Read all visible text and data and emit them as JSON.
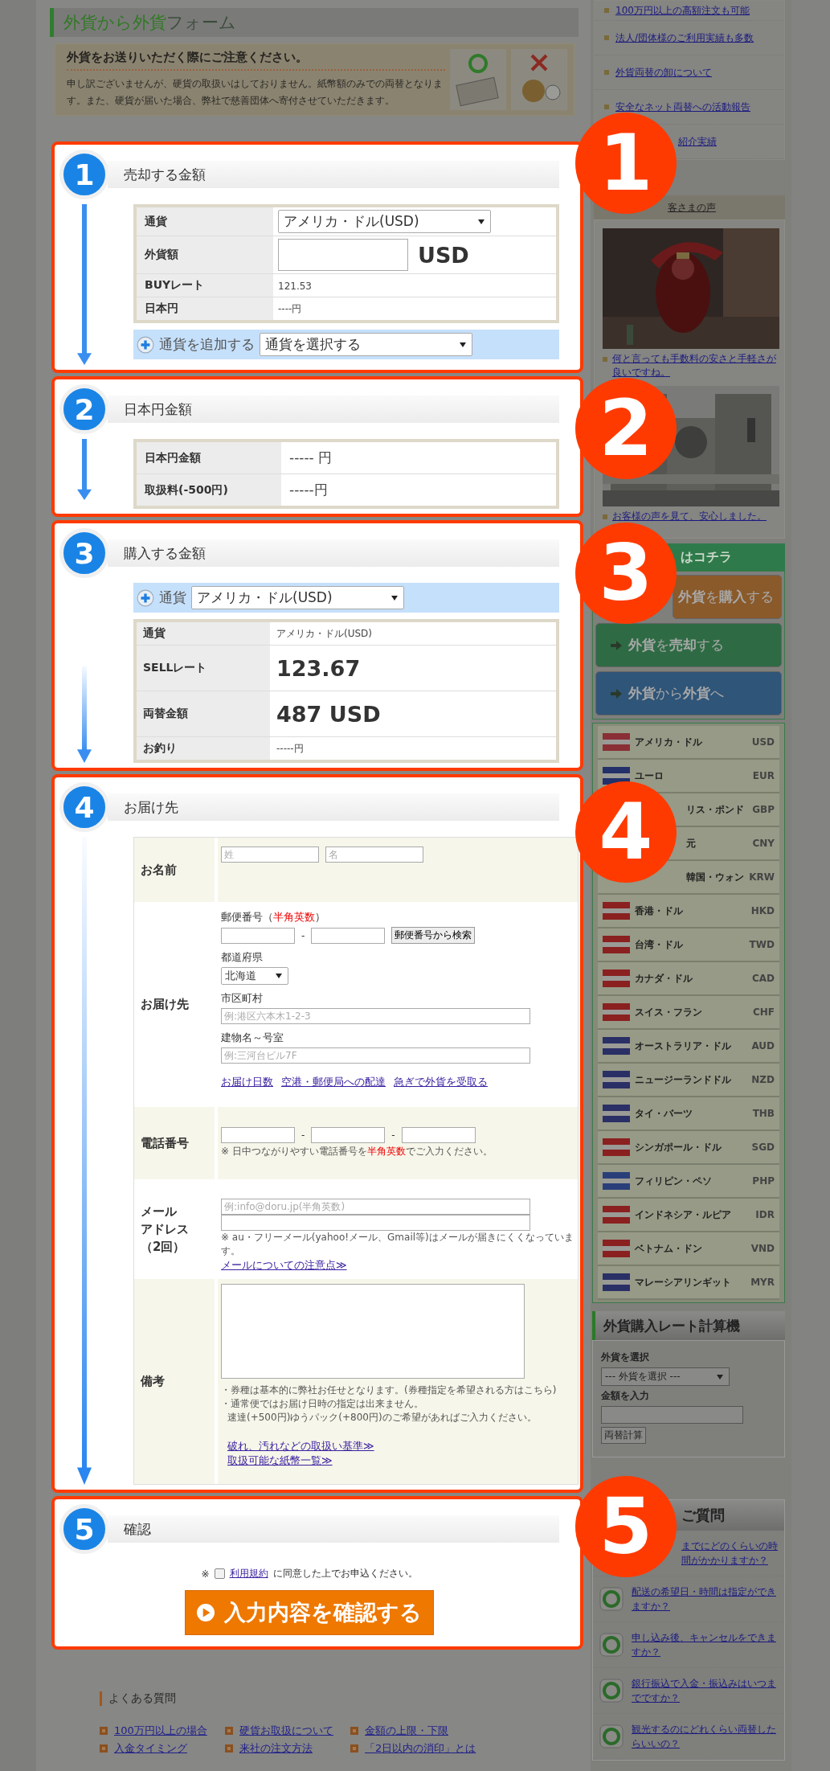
{
  "page_title": {
    "accent": "外貨から外貨",
    "rest": "フォーム"
  },
  "notice": {
    "heading": "外貨をお送りいただく際にご注意ください。",
    "body": "申し訳ございませんが、硬貨の取扱いはしておりません。紙幣額のみでの両替となります。また、硬貨が届いた場合、弊社で慈善団体へ寄付させていただきます。"
  },
  "sell": {
    "step": "1",
    "title": "売却する金額",
    "rows": [
      {
        "label": "通貨",
        "kind": "select",
        "value": "アメリカ・ドル(USD)"
      },
      {
        "label": "外貨額",
        "kind": "input",
        "unit": "USD"
      },
      {
        "label": "BUYレート",
        "kind": "text",
        "value": "121.53"
      },
      {
        "label": "日本円",
        "kind": "text",
        "value": "----円"
      }
    ],
    "add_label": "通貨を追加する",
    "add_select": "通貨を選択する"
  },
  "yen": {
    "step": "2",
    "title": "日本円金額",
    "rows": [
      {
        "label": "日本円金額",
        "kind": "mid",
        "value": "----- 円"
      },
      {
        "label": "取扱料(-500円)",
        "kind": "mid",
        "value": "-----円"
      }
    ]
  },
  "buy": {
    "step": "3",
    "title": "購入する金額",
    "currency_label": "通貨",
    "currency_select": "アメリカ・ドル(USD)",
    "rows": [
      {
        "label": "通貨",
        "kind": "text",
        "value": "アメリカ・ドル(USD)"
      },
      {
        "label": "SELLレート",
        "kind": "big",
        "value": "123.67"
      },
      {
        "label": "両替金額",
        "kind": "big",
        "value": "487  USD"
      },
      {
        "label": "お釣り",
        "kind": "text",
        "value": "-----円"
      }
    ]
  },
  "delivery": {
    "step": "4",
    "title": "お届け先",
    "name": {
      "label": "お名前",
      "last_placeholder": "姓",
      "first_placeholder": "名"
    },
    "address": {
      "label": "お届け先",
      "postal_before": "郵便番号（",
      "postal_red": "半角英数",
      "postal_after": "）",
      "separator": "-",
      "postal_button": "郵便番号から検索",
      "pref_label": "都道府県",
      "pref_value": "北海道",
      "city_label": "市区町村",
      "city_placeholder": "例:港区六本木1-2-3",
      "building_label": "建物名～号室",
      "building_placeholder": "例:三河台ビル7F",
      "links": [
        "お届け日数",
        "空港・郵便局への配達",
        "急ぎで外貨を受取る"
      ]
    },
    "phone": {
      "label": "電話番号",
      "separators": [
        "-",
        "-"
      ],
      "note_before": "※ 日中つながりやすい電話番号を",
      "note_red": "半角英数",
      "note_after": "でご入力ください。"
    },
    "email": {
      "label_lines": [
        "メール",
        "アドレス",
        "（2回）"
      ],
      "placeholder": "例:info@doru.jp(半角英数)",
      "note": "※ au・フリーメール(yahoo!メール、Gmail等)はメールが届きにくくなっています。",
      "link": "メールについての注意点≫"
    },
    "remarks": {
      "label": "備考",
      "line1_before": "・券種は基本的に弊社お任せとなります。(",
      "line1_link": "券種指定を希望される方はこちら",
      "line1_after": ")",
      "line2_before": "・通常便では",
      "line2_link": "お届け日時の指定",
      "line2_after": "は出来ません。",
      "line3": "速達(+500円)ゆうパック(+800円)のご希望があればご入力ください。",
      "links": [
        "破れ、汚れなどの取扱い基準≫",
        "取扱可能な紙幣一覧≫"
      ]
    }
  },
  "confirm": {
    "step": "5",
    "title": "確認",
    "prefix": "※",
    "checked": false,
    "terms_link": "利用規約",
    "terms_after": "に同意した上でお申込ください。",
    "button": "入力内容を確認する"
  },
  "faq_footer": {
    "title": "よくある質問",
    "links": [
      "100万円以上の場合",
      "硬貨お取扱について",
      "金額の上限・下限",
      "入金タイミング",
      "来社の注文方法",
      "「2日以内の消印」とは"
    ]
  },
  "sidebar": {
    "links": [
      {
        "text": "100万円以上の高額注文も可能",
        "partly_covered": false
      },
      {
        "text": "法人/団体様のご利用実績も多数",
        "partly_covered": false
      },
      {
        "text": "外貨両替の卸について",
        "partly_covered": false
      },
      {
        "text": "安全なネット両替への活動報告",
        "partly_covered": false
      },
      {
        "text": "紹介実績",
        "partly_covered": true
      }
    ],
    "voices_title": "客さまの声",
    "voices": [
      {
        "kind": "performer",
        "caption": "何と言っても手数料の安さと手軽さが良いですね。"
      },
      {
        "kind": "cathedral",
        "caption": "お客様の声を見て、安心しました。"
      }
    ],
    "shortcut_title": "はコチラ",
    "shortcut_buttons": [
      {
        "label": "**外貨**を**購入**する",
        "color": "#8a5a2a",
        "partly_covered": true
      },
      {
        "label": "**外貨**を**売却**する",
        "color": "#2e6b44",
        "partly_covered": false
      },
      {
        "label": "**外貨**から**外貨**へ",
        "color": "#2f5578",
        "partly_covered": false
      }
    ],
    "currencies": [
      {
        "name": "アメリカ・ドル",
        "code": "USD",
        "color": "#8a2f35",
        "partly_covered": false
      },
      {
        "name": "ユーロ",
        "code": "EUR",
        "color": "#23306a",
        "partly_covered": false
      },
      {
        "name": "リス・ポンド",
        "code": "GBP",
        "partly_covered": true
      },
      {
        "name": "元",
        "code": "CNY",
        "partly_covered": true
      },
      {
        "name": "韓国・ウォン",
        "code": "KRW",
        "partly_covered": true
      },
      {
        "name": "香港・ドル",
        "code": "HKD",
        "color": "#8a2020",
        "partly_covered": false
      },
      {
        "name": "台湾・ドル",
        "code": "TWD",
        "color": "#8a2020",
        "partly_covered": false
      },
      {
        "name": "カナダ・ドル",
        "code": "CAD",
        "color": "#8a2020",
        "partly_covered": false
      },
      {
        "name": "スイス・フラン",
        "code": "CHF",
        "color": "#8a2020",
        "partly_covered": false
      },
      {
        "name": "オーストラリア・ドル",
        "code": "AUD",
        "color": "#2a2f66",
        "partly_covered": false
      },
      {
        "name": "ニュージーランドドル",
        "code": "NZD",
        "color": "#2a2f66",
        "partly_covered": false
      },
      {
        "name": "タイ・バーツ",
        "code": "THB",
        "color": "#2a2f66",
        "partly_covered": false
      },
      {
        "name": "シンガポール・ドル",
        "code": "SGD",
        "color": "#8a2020",
        "partly_covered": false
      },
      {
        "name": "フィリピン・ペソ",
        "code": "PHP",
        "color": "#2a3f7a",
        "partly_covered": false
      },
      {
        "name": "インドネシア・ルピア",
        "code": "IDR",
        "color": "#8a2020",
        "partly_covered": false
      },
      {
        "name": "ベトナム・ドン",
        "code": "VND",
        "color": "#8a2020",
        "partly_covered": false
      },
      {
        "name": "マレーシアリンギット",
        "code": "MYR",
        "color": "#2a2f66",
        "partly_covered": false
      }
    ],
    "calculator": {
      "title": "外貨購入レート計算機",
      "currency_label": "外貨を選択",
      "currency_select": "--- 外貨を選択 ---",
      "amount_label": "金額を入力",
      "button": "両替計算"
    },
    "faq": {
      "title": "ご質問",
      "items": [
        {
          "text": "までにどのくらいの時間がかかりますか？",
          "partly_covered": true
        },
        {
          "text": "配送の希望日・時間は指定ができますか？",
          "partly_covered": false
        },
        {
          "text": "申し込み後、キャンセルをできますか？",
          "partly_covered": false
        },
        {
          "text": "銀行振込で入金・振込みはいつまでですか？",
          "partly_covered": false
        },
        {
          "text": "観光するのにどれくらい両替したらいいの？",
          "partly_covered": false
        }
      ]
    }
  },
  "markers": [
    "1",
    "2",
    "3",
    "4",
    "5"
  ]
}
